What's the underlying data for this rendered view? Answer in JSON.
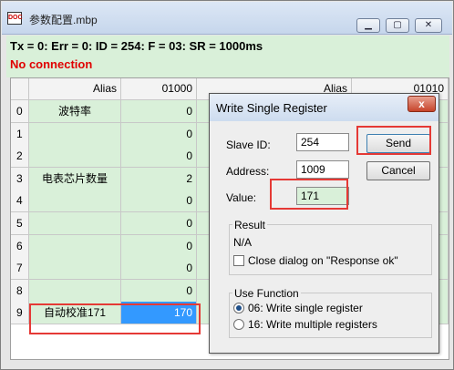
{
  "window": {
    "title": "参数配置.mbp",
    "icon_text": "DOC",
    "controls": {
      "minimize": "▁",
      "maximize": "▢",
      "close": "✕"
    }
  },
  "status": {
    "line": "Tx = 0: Err = 0: ID = 254: F = 03: SR = 1000ms",
    "connection": "No connection"
  },
  "grid": {
    "left_header": {
      "alias": "Alias",
      "value": "01000"
    },
    "right_header": {
      "alias": "Alias",
      "value": "01010"
    },
    "rows": [
      {
        "num": "0",
        "alias": "波特率",
        "value": "0"
      },
      {
        "num": "1",
        "alias": "",
        "value": "0"
      },
      {
        "num": "2",
        "alias": "",
        "value": "0"
      },
      {
        "num": "3",
        "alias": "电表芯片数量",
        "value": "2"
      },
      {
        "num": "4",
        "alias": "",
        "value": "0"
      },
      {
        "num": "5",
        "alias": "",
        "value": "0"
      },
      {
        "num": "6",
        "alias": "",
        "value": "0"
      },
      {
        "num": "7",
        "alias": "",
        "value": "0"
      },
      {
        "num": "8",
        "alias": "",
        "value": "0"
      },
      {
        "num": "9",
        "alias": "自动校准171",
        "value": "170"
      }
    ]
  },
  "dialog": {
    "title": "Write Single Register",
    "close": "x",
    "slave_id_label": "Slave ID:",
    "slave_id_value": "254",
    "address_label": "Address:",
    "address_value": "1009",
    "value_label": "Value:",
    "value_value": "171",
    "send_label": "Send",
    "cancel_label": "Cancel",
    "result_title": "Result",
    "result_value": "N/A",
    "close_on_ok_label": "Close dialog on \"Response ok\"",
    "use_function_title": "Use Function",
    "function_06": "06: Write single register",
    "function_16": "16: Write multiple registers"
  },
  "colors": {
    "highlight_box": "#e53935",
    "selected_cell": "#3399ff",
    "connection_error": "#e00000"
  }
}
